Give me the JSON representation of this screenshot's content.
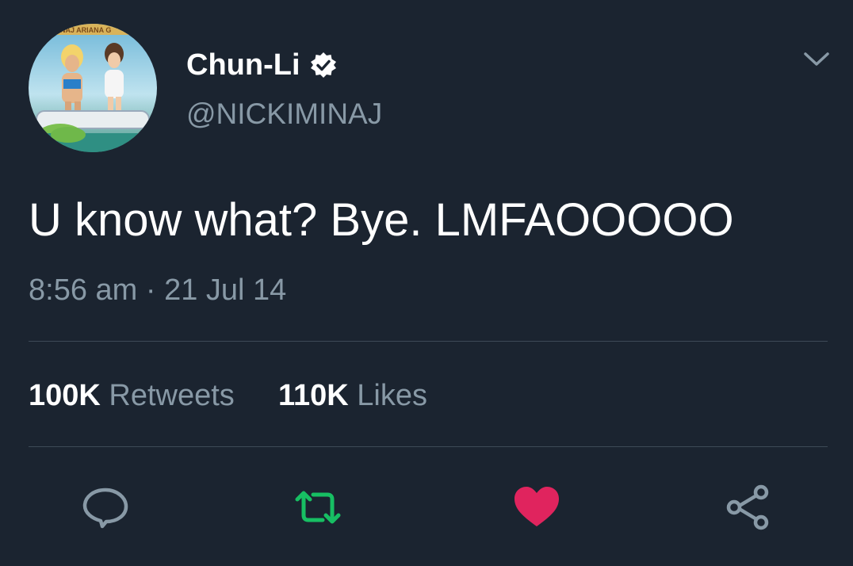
{
  "user": {
    "display_name": "Chun-Li",
    "handle": "@NICKIMINAJ",
    "verified_icon": "verified-badge-icon",
    "avatar_banner_text": "MINAJ  ARIANA G"
  },
  "tweet": {
    "text": "U know what? Bye. LMFAOOOOO",
    "time": "8:56 am",
    "separator": "·",
    "date": "21 Jul 14"
  },
  "stats": {
    "retweets_count": "100K",
    "retweets_label": "Retweets",
    "likes_count": "110K",
    "likes_label": "Likes"
  },
  "actions": {
    "reply_icon": "reply-icon",
    "retweet_icon": "retweet-icon",
    "like_icon": "heart-icon",
    "share_icon": "share-icon"
  },
  "colors": {
    "background": "#1b2430",
    "secondary_text": "#8899a6",
    "retweet_active": "#17bf63",
    "like_active": "#e0245e"
  }
}
